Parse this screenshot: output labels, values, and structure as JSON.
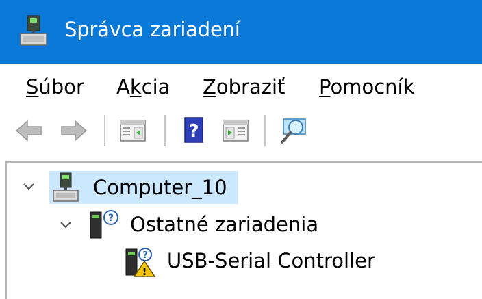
{
  "window": {
    "title": "Správca zariadení",
    "title_icon": "computer-icon"
  },
  "menu": {
    "items": [
      {
        "label_pre": "",
        "label_key": "S",
        "label_post": "úbor"
      },
      {
        "label_pre": "A",
        "label_key": "k",
        "label_post": "cia"
      },
      {
        "label_pre": "",
        "label_key": "Z",
        "label_post": "obraziť"
      },
      {
        "label_pre": "",
        "label_key": "P",
        "label_post": "omocník"
      }
    ]
  },
  "toolbar": {
    "buttons": [
      "back-arrow-icon",
      "forward-arrow-icon",
      "properties-panel-icon",
      "help-icon",
      "update-driver-icon",
      "scan-hardware-icon"
    ]
  },
  "tree": {
    "root": {
      "label": "Computer_10",
      "icon": "computer-icon",
      "expanded": true,
      "selected": true
    },
    "category": {
      "label": "Ostatné zariadenia",
      "icon": "unknown-device-icon",
      "expanded": true
    },
    "device": {
      "label": "USB-Serial Controller",
      "icon": "device-warning-icon"
    }
  },
  "colors": {
    "titlebar": "#0a78d7",
    "selection": "#cce8ff",
    "warning": "#f5c400"
  }
}
